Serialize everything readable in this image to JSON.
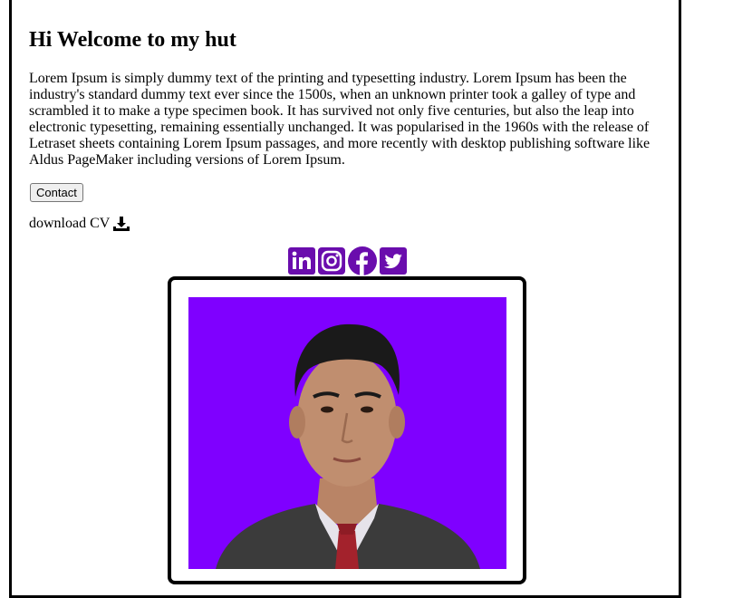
{
  "page": {
    "heading": "Hi Welcome to my hut",
    "paragraph": "Lorem Ipsum is simply dummy text of the printing and typesetting industry. Lorem Ipsum has been the industry's standard dummy text ever since the 1500s, when an unknown printer took a galley of type and scrambled it to make a type specimen book. It has survived not only five centuries, but also the leap into electronic typesetting, remaining essentially unchanged. It was popularised in the 1960s with the release of Letraset sheets containing Lorem Ipsum passages, and more recently with desktop publishing software like Aldus PageMaker including versions of Lorem Ipsum.",
    "contact_button": "Contact",
    "download_label": "download CV"
  },
  "icons": {
    "download": "download-icon",
    "socials": [
      "linkedin-icon",
      "instagram-icon",
      "facebook-icon",
      "twitter-icon"
    ]
  },
  "colors": {
    "social_purple": "#6a0dad",
    "photo_background": "#7f00ff",
    "border": "#000000"
  }
}
